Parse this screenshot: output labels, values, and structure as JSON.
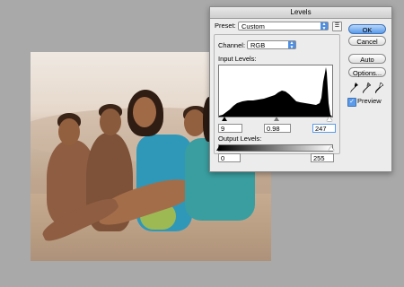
{
  "dialog": {
    "title": "Levels",
    "preset": {
      "label": "Preset:",
      "value": "Custom"
    },
    "channel": {
      "label": "Channel:",
      "value": "RGB"
    },
    "input_levels": {
      "label": "Input Levels:",
      "black": "9",
      "gamma": "0.98",
      "white": "247"
    },
    "output_levels": {
      "label": "Output Levels:",
      "black": "0",
      "white": "255"
    },
    "buttons": {
      "ok": "OK",
      "cancel": "Cancel",
      "auto": "Auto",
      "options": "Options..."
    },
    "preview": {
      "label": "Preview",
      "checked": true
    }
  },
  "colors": {
    "accent": "#5b9bea",
    "dialog_bg": "#ececec",
    "desktop": "#a9a9a9"
  }
}
